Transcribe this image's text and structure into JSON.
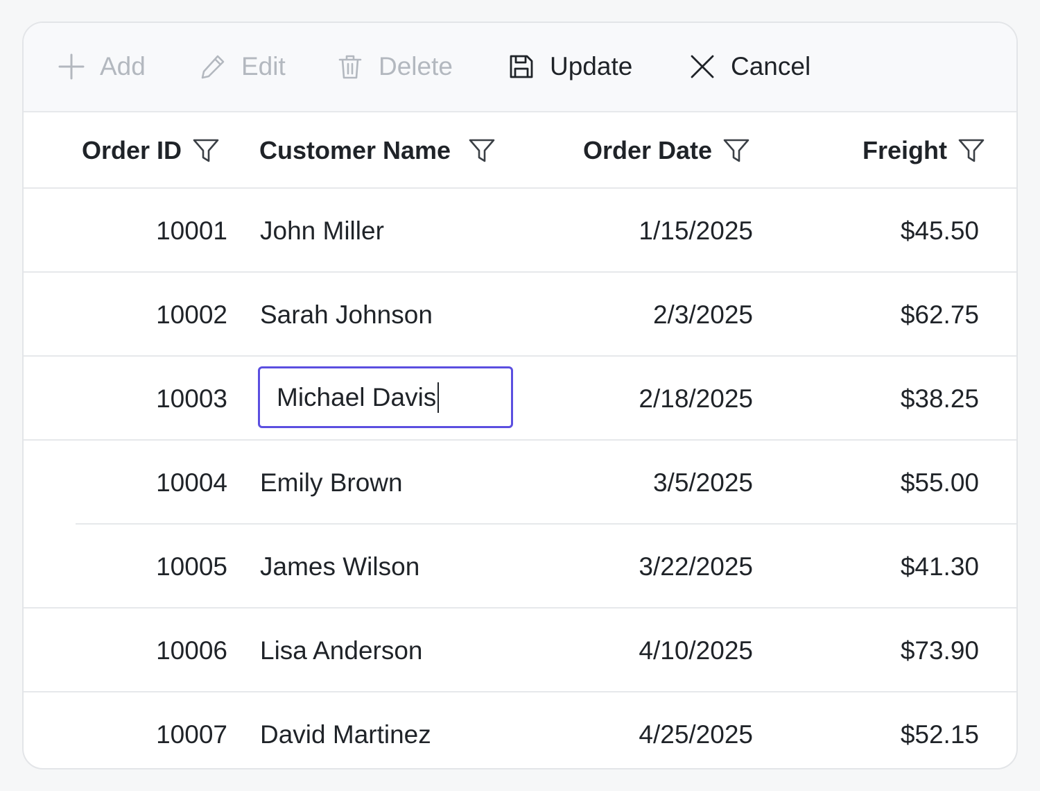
{
  "toolbar": {
    "add": {
      "label": "Add",
      "icon": "plus-icon",
      "enabled": false
    },
    "edit": {
      "label": "Edit",
      "icon": "pencil-icon",
      "enabled": false
    },
    "delete": {
      "label": "Delete",
      "icon": "trash-icon",
      "enabled": false
    },
    "update": {
      "label": "Update",
      "icon": "save-icon",
      "enabled": true
    },
    "cancel": {
      "label": "Cancel",
      "icon": "close-icon",
      "enabled": true
    }
  },
  "columns": [
    {
      "key": "order_id",
      "label": "Order ID",
      "icon": "filter-icon"
    },
    {
      "key": "customer_name",
      "label": "Customer Name",
      "icon": "filter-icon"
    },
    {
      "key": "order_date",
      "label": "Order Date",
      "icon": "filter-icon"
    },
    {
      "key": "freight",
      "label": "Freight",
      "icon": "filter-icon"
    }
  ],
  "rows": [
    {
      "order_id": "10001",
      "customer_name": "John Miller",
      "order_date": "1/15/2025",
      "freight": "$45.50"
    },
    {
      "order_id": "10002",
      "customer_name": "Sarah Johnson",
      "order_date": "2/3/2025",
      "freight": "$62.75"
    },
    {
      "order_id": "10003",
      "customer_name": "Michael Davis",
      "order_date": "2/18/2025",
      "freight": "$38.25",
      "editing": true
    },
    {
      "order_id": "10004",
      "customer_name": "Emily Brown",
      "order_date": "3/5/2025",
      "freight": "$55.00"
    },
    {
      "order_id": "10005",
      "customer_name": "James Wilson",
      "order_date": "3/22/2025",
      "freight": "$41.30"
    },
    {
      "order_id": "10006",
      "customer_name": "Lisa Anderson",
      "order_date": "4/10/2025",
      "freight": "$73.90"
    },
    {
      "order_id": "10007",
      "customer_name": "David Martinez",
      "order_date": "4/25/2025",
      "freight": "$52.15"
    }
  ],
  "colors": {
    "edit_border": "#5b4fe0",
    "disabled_text": "#b3b8bf",
    "text": "#1f2328",
    "toolbar_bg": "#f8f9fb"
  }
}
